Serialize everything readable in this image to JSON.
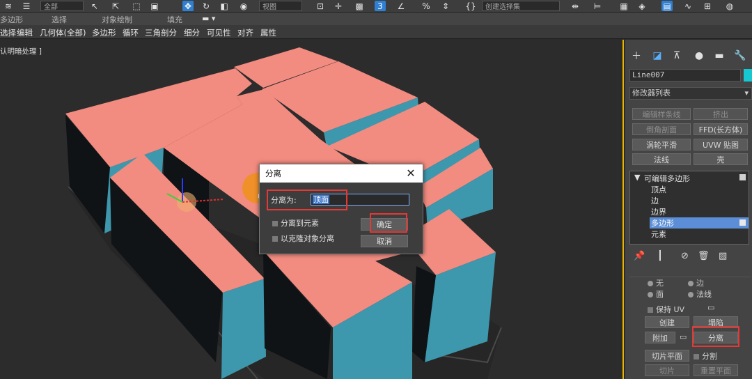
{
  "toolbar": {
    "selection_set": "全部",
    "named_selection": "视图",
    "selection_filter": "创建选择集"
  },
  "ribbon": {
    "labels": [
      "多边形",
      "选择",
      "对象绘制",
      "填充"
    ]
  },
  "menu": {
    "items": [
      "选择",
      "编辑",
      "几何体(全部)",
      "多边形",
      "循环",
      "三角剖分",
      "细分",
      "可见性",
      "对齐",
      "属性"
    ]
  },
  "viewport": {
    "label": "认明暗处理 ]"
  },
  "colors": {
    "top_face": "#f28b80",
    "side_face": "#3d97ad",
    "dark_face": "#101417",
    "accent_blue": "#2f7fd3",
    "highlight_red": "#e53935",
    "object_color": "#18c8d0"
  },
  "command_panel": {
    "object_name": "Line007",
    "modifier_list": "修改器列表",
    "buttons": [
      {
        "label": "编辑样条线",
        "enabled": false
      },
      {
        "label": "挤出",
        "enabled": false
      },
      {
        "label": "倒角剖面",
        "enabled": false
      },
      {
        "label": "FFD(长方体)",
        "enabled": true
      },
      {
        "label": "涡轮平滑",
        "enabled": true
      },
      {
        "label": "UVW 贴图",
        "enabled": true
      },
      {
        "label": "法线",
        "enabled": true
      },
      {
        "label": "壳",
        "enabled": true
      }
    ],
    "stack": {
      "title": "可编辑多边形",
      "items": [
        "顶点",
        "边",
        "边界",
        "多边形",
        "元素"
      ],
      "selected": "多边形"
    },
    "radio_top_left": "无",
    "radio_top_right": "边",
    "radio_face": "面",
    "radio_normal": "法线",
    "preserve_uv": "保持 UV",
    "create": "创建",
    "collapse": "塌陷",
    "attach": "附加",
    "detach": "分离",
    "slice_plane": "切片平面",
    "split": "分割",
    "slice": "切片",
    "reset_plane": "重置平面"
  },
  "dialog": {
    "title": "分离",
    "detach_as_label": "分离为:",
    "detach_as_value": "顶面",
    "to_element": "分离到元素",
    "as_clone": "以克隆对象分离",
    "ok": "确定",
    "cancel": "取消"
  }
}
